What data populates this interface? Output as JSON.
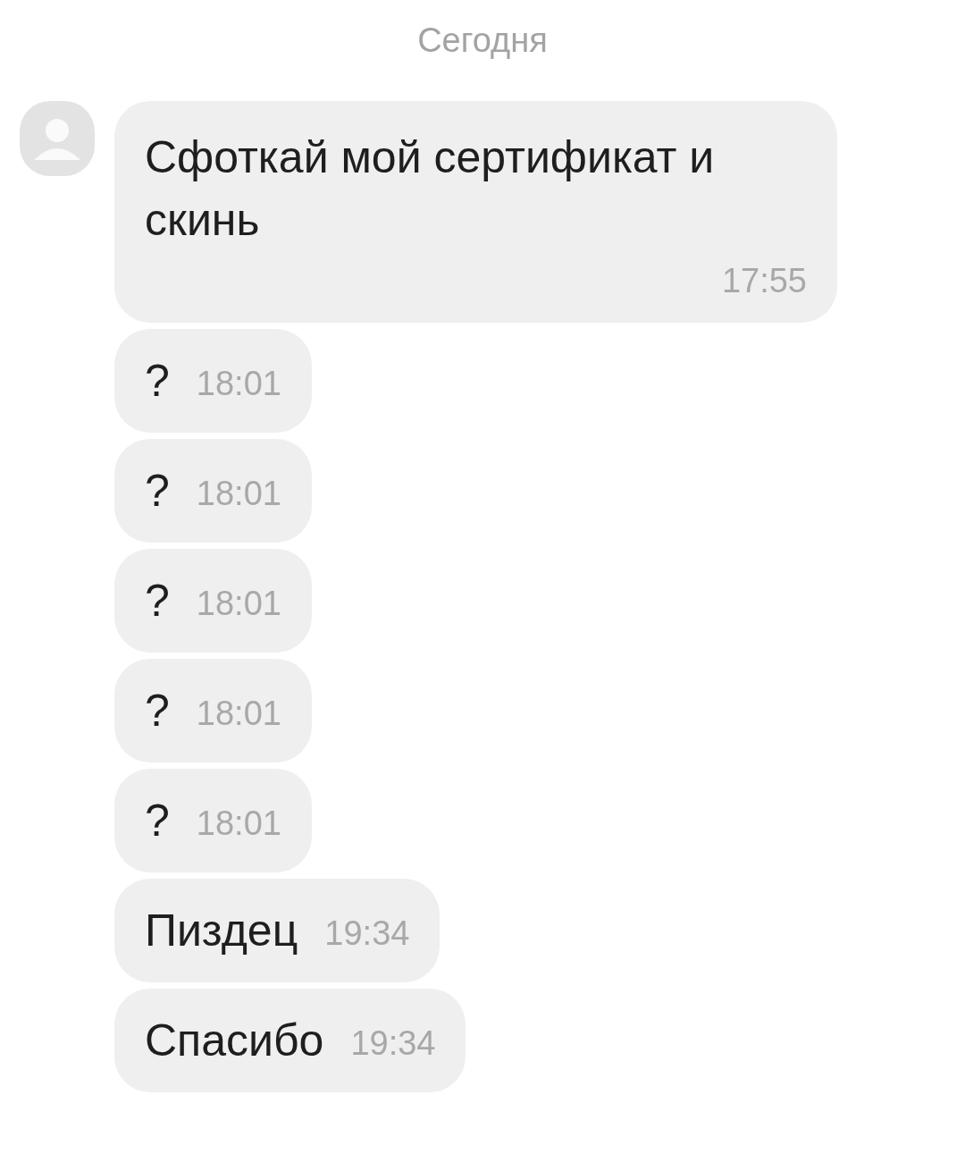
{
  "date_header": "Сегодня",
  "messages": [
    {
      "kind": "stacked",
      "text": "Сфоткай мой сертификат и скинь",
      "time": "17:55"
    },
    {
      "kind": "inline",
      "text": "?",
      "time": "18:01"
    },
    {
      "kind": "inline",
      "text": "?",
      "time": "18:01"
    },
    {
      "kind": "inline",
      "text": "?",
      "time": "18:01"
    },
    {
      "kind": "inline",
      "text": "?",
      "time": "18:01"
    },
    {
      "kind": "inline",
      "text": "?",
      "time": "18:01"
    },
    {
      "kind": "inline",
      "text": "Пиздец",
      "time": "19:34"
    },
    {
      "kind": "inline",
      "text": "Спасибо",
      "time": "19:34"
    }
  ]
}
